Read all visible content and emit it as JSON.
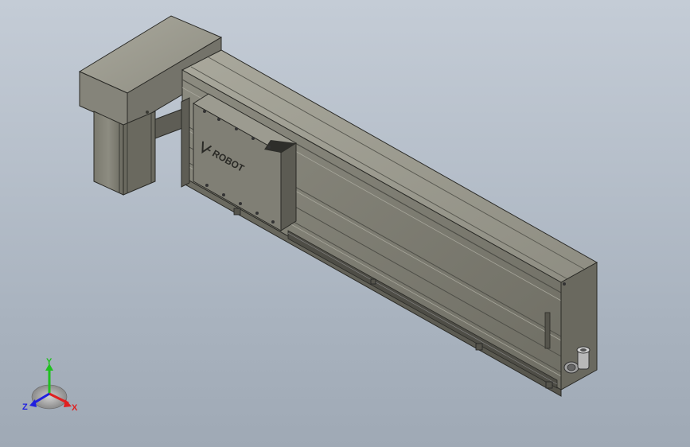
{
  "viewport": {
    "background_top": "#c4ccd6",
    "background_bottom": "#9fa9b5"
  },
  "model": {
    "body_color": "#8a8a80",
    "brand_logo_text": "ROBOT"
  },
  "triad": {
    "x_label": "X",
    "y_label": "Y",
    "z_label": "Z",
    "x_color": "#e02020",
    "y_color": "#20c020",
    "z_color": "#2020e0"
  }
}
